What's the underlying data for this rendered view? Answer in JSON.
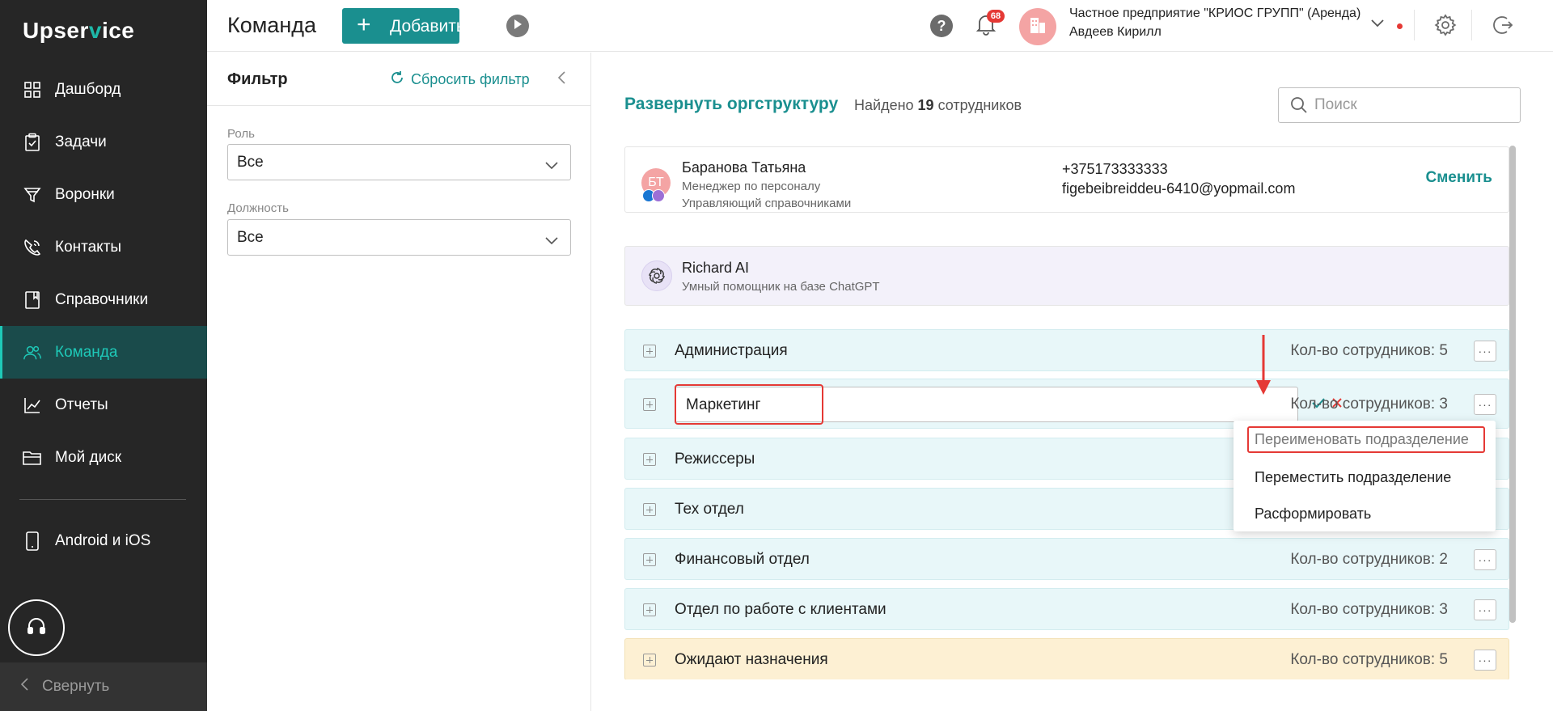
{
  "app": {
    "logo_pre": "Upser",
    "logo_v": "v",
    "logo_post": "ice"
  },
  "sidebar": {
    "items": [
      {
        "label": "Дашборд",
        "icon": "dashboard-icon"
      },
      {
        "label": "Задачи",
        "icon": "tasks-icon"
      },
      {
        "label": "Воронки",
        "icon": "funnel-icon"
      },
      {
        "label": "Контакты",
        "icon": "contacts-icon"
      },
      {
        "label": "Справочники",
        "icon": "book-icon"
      },
      {
        "label": "Команда",
        "icon": "team-icon",
        "active": true
      },
      {
        "label": "Отчеты",
        "icon": "chart-icon"
      },
      {
        "label": "Мой диск",
        "icon": "folder-icon"
      }
    ],
    "mobile": "Android и iOS",
    "collapse": "Свернуть"
  },
  "header": {
    "title": "Команда",
    "add_label": "Добавить",
    "notifications": "68",
    "company": "Частное предприятие \"КРИОС ГРУПП\" (Аренда)",
    "user": "Авдеев Кирилл",
    "colors": {
      "accent": "#1a8f8f",
      "alert": "#e53935"
    }
  },
  "filter": {
    "title": "Фильтр",
    "reset": "Сбросить фильтр",
    "role_label": "Роль",
    "role_value": "Все",
    "position_label": "Должность",
    "position_value": "Все"
  },
  "main": {
    "expand": "Развернуть оргструктуру",
    "found_prefix": "Найдено",
    "found_count": "19",
    "found_suffix": "сотрудников",
    "search_placeholder": "Поиск",
    "manager": {
      "initials": "БТ",
      "name": "Баранова Татьяна",
      "role1": "Менеджер по персоналу",
      "role2": "Управляющий справочниками",
      "phone": "+375173333333",
      "email": "figebeibreiddeu-6410@yopmail.com",
      "change": "Сменить"
    },
    "ai": {
      "name": "Richard AI",
      "desc": "Умный помощник на базе ChatGPT"
    },
    "departments": [
      {
        "name": "Администрация",
        "count": "Кол-во сотрудников: 5"
      },
      {
        "name": "Маркетинг",
        "count": "Кол-во сотрудников: 3",
        "editing": true
      },
      {
        "name": "Режиссеры",
        "count": ""
      },
      {
        "name": "Тех отдел",
        "count": ""
      },
      {
        "name": "Финансовый отдел",
        "count": "Кол-во сотрудников: 2"
      },
      {
        "name": "Отдел по работе с клиентами",
        "count": "Кол-во сотрудников: 3"
      },
      {
        "name": "Ожидают назначения",
        "count": "Кол-во сотрудников: 5",
        "waiting": true
      }
    ],
    "menu": {
      "rename": "Переименовать подразделение",
      "move": "Переместить подразделение",
      "disband": "Расформировать"
    }
  }
}
